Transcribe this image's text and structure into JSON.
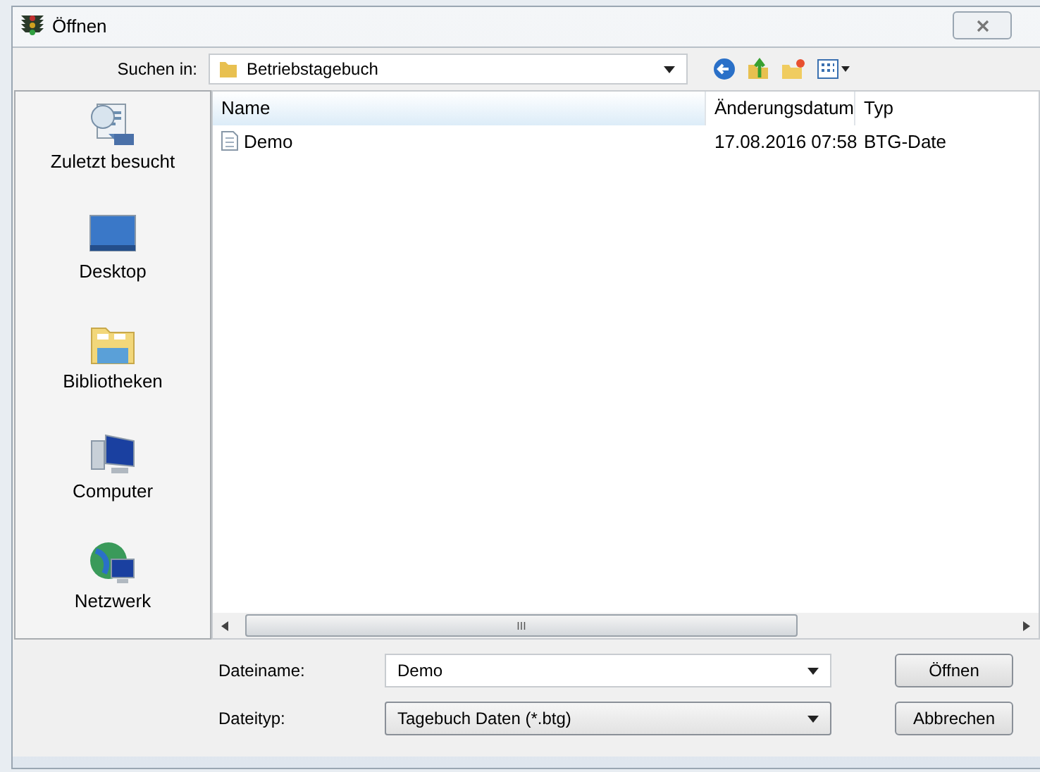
{
  "window": {
    "title": "Öffnen"
  },
  "look_in": {
    "label": "Suchen in:",
    "value": "Betriebstagebuch"
  },
  "sidebar": {
    "items": [
      {
        "label": "Zuletzt besucht",
        "kind": "recent"
      },
      {
        "label": "Desktop",
        "kind": "desktop"
      },
      {
        "label": "Bibliotheken",
        "kind": "libraries"
      },
      {
        "label": "Computer",
        "kind": "computer"
      },
      {
        "label": "Netzwerk",
        "kind": "network"
      }
    ]
  },
  "table": {
    "columns": [
      {
        "label": "Name",
        "selected": true
      },
      {
        "label": "Änderungsdatum",
        "selected": false
      },
      {
        "label": "Typ",
        "selected": false
      }
    ],
    "rows": [
      {
        "cells": [
          "Demo",
          "17.08.2016 07:58",
          "BTG-Date"
        ]
      }
    ]
  },
  "scroll_thumb": {
    "label": "III"
  },
  "filename": {
    "label": "Dateiname:",
    "value": "Demo"
  },
  "filetype": {
    "label": "Dateityp:",
    "value": "Tagebuch Daten (*.btg)"
  },
  "buttons": [
    "Öffnen",
    "Abbrechen"
  ]
}
